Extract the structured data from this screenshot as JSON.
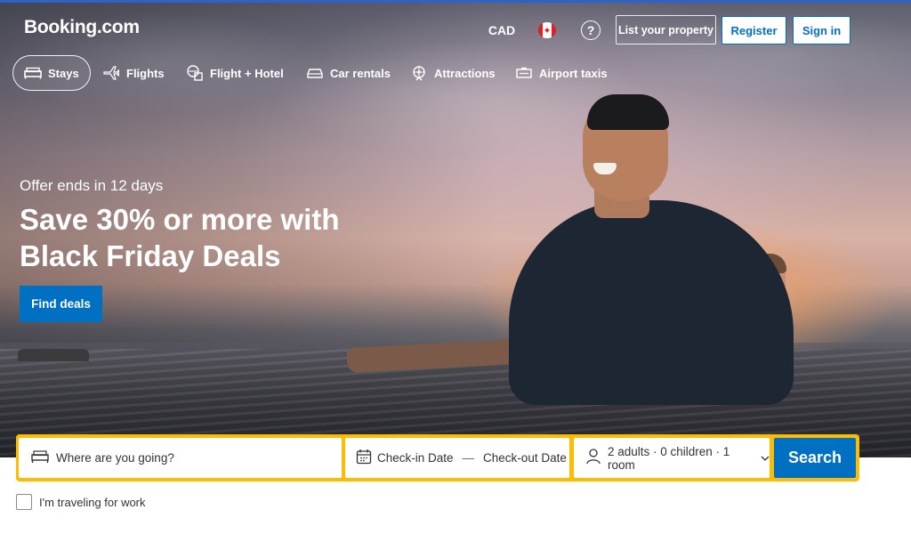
{
  "header": {
    "logo": "Booking.com",
    "currency": "CAD",
    "help_symbol": "?",
    "list_property": "List your property",
    "register": "Register",
    "sign_in": "Sign in"
  },
  "nav": {
    "items": [
      {
        "label": "Stays",
        "icon": "bed-icon",
        "active": true
      },
      {
        "label": "Flights",
        "icon": "plane-icon"
      },
      {
        "label": "Flight + Hotel",
        "icon": "flight-hotel-icon"
      },
      {
        "label": "Car rentals",
        "icon": "car-icon"
      },
      {
        "label": "Attractions",
        "icon": "attractions-icon"
      },
      {
        "label": "Airport taxis",
        "icon": "taxi-icon"
      }
    ]
  },
  "hero": {
    "offer": "Offer ends in 12 days",
    "headline": "Save 30% or more with Black Friday Deals",
    "cta": "Find deals"
  },
  "search": {
    "destination_placeholder": "Where are you going?",
    "check_in": "Check-in Date",
    "date_separator": "—",
    "check_out": "Check-out Date",
    "guests": "2 adults · 0 children · 1 room",
    "button": "Search"
  },
  "work_travel": {
    "label": "I'm traveling for work",
    "checked": false
  },
  "colors": {
    "brand_blue": "#0071c2",
    "search_border": "#febb02"
  }
}
